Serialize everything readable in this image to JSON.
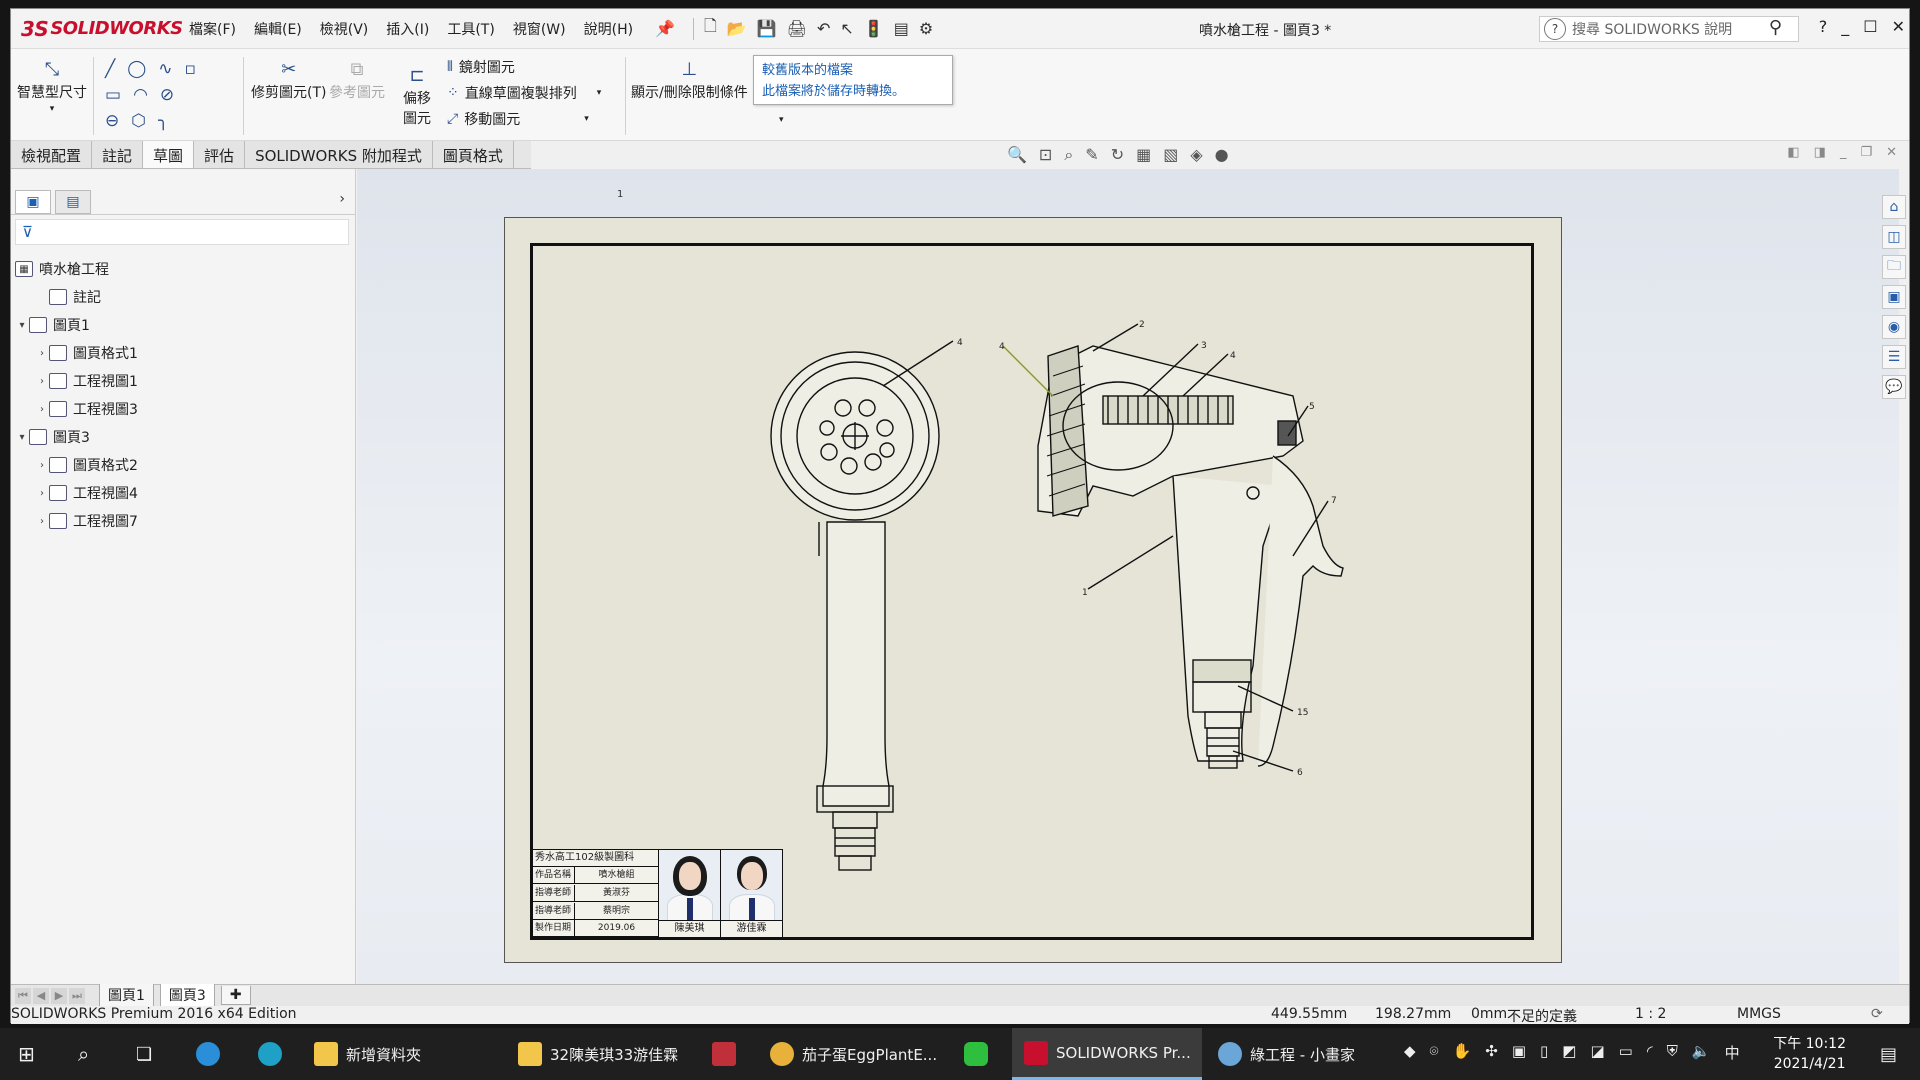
{
  "app": {
    "brand_prefix": "3S",
    "brand": "SOLIDWORKS",
    "document_title": "噴水槍工程 - 圖頁3 *",
    "menus": [
      "檔案(F)",
      "編輯(E)",
      "檢視(V)",
      "插入(I)",
      "工具(T)",
      "視窗(W)",
      "說明(H)"
    ],
    "search_placeholder": "搜尋 SOLIDWORKS 說明",
    "help_label": "?"
  },
  "ribbon": {
    "smart_dimension": "智慧型尺寸",
    "trim_entities": "修剪圖元(T)",
    "convert_entities": "參考圖元",
    "offset_entities": "偏移圖元",
    "mirror_entities": "鏡射圖元",
    "linear_pattern": "直線草圖複製排列",
    "move_entities": "移動圖元",
    "display_relations": "顯示/刪除限制條件"
  },
  "tooltip": {
    "line1": "較舊版本的檔案",
    "line2": "此檔案將於儲存時轉換。"
  },
  "tabs": [
    "檢視配置",
    "註記",
    "草圖",
    "評估",
    "SOLIDWORKS 附加程式",
    "圖頁格式"
  ],
  "tree": {
    "root": "噴水槍工程",
    "items": [
      {
        "label": "註記",
        "level": 1,
        "expander": ""
      },
      {
        "label": "圖頁1",
        "level": 0,
        "expander": "▾"
      },
      {
        "label": "圖頁格式1",
        "level": 1,
        "expander": "›"
      },
      {
        "label": "工程視圖1",
        "level": 1,
        "expander": "›"
      },
      {
        "label": "工程視圖3",
        "level": 1,
        "expander": "›"
      },
      {
        "label": "圖頁3",
        "level": 0,
        "expander": "▾"
      },
      {
        "label": "圖頁格式2",
        "level": 1,
        "expander": "›"
      },
      {
        "label": "工程視圖4",
        "level": 1,
        "expander": "›"
      },
      {
        "label": "工程視圖7",
        "level": 1,
        "expander": "›"
      }
    ]
  },
  "drawing": {
    "page_mark": "1",
    "balloons": [
      "4",
      "2",
      "3",
      "4",
      "5",
      "7",
      "1",
      "4",
      "15",
      "6"
    ]
  },
  "title_block": {
    "header": "秀水高工102級製圖科",
    "rows": [
      {
        "key": "作品名稱",
        "value": "噴水槍組"
      },
      {
        "key": "指導老師",
        "value": "黃淑芬"
      },
      {
        "key": "指導老師",
        "value": "蔡明宗"
      },
      {
        "key": "製作日期",
        "value": "2019.06"
      }
    ],
    "students": [
      "陳美琪",
      "游佳霖"
    ]
  },
  "sheet_tabs": [
    "圖頁1",
    "圖頁3"
  ],
  "status": {
    "edition": "SOLIDWORKS Premium 2016 x64 Edition",
    "x": "449.55mm",
    "y": "198.27mm",
    "z": "0mm",
    "definition": "不足的定義",
    "scale": "1 : 2",
    "units": "MMGS"
  },
  "taskbar": {
    "items": [
      "新增資料夾",
      "32陳美琪33游佳霖",
      "茄子蛋EggPlantE...",
      "SOLIDWORKS Pr...",
      "綠工程 - 小畫家"
    ],
    "ime": "中",
    "time": "下午 10:12",
    "date": "2021/4/21"
  },
  "colors": {
    "brand_red": "#c8102e",
    "sheet_bg": "#e5e4d7",
    "link_blue": "#1a5fb4",
    "taskbar": "#1f1f1f"
  }
}
